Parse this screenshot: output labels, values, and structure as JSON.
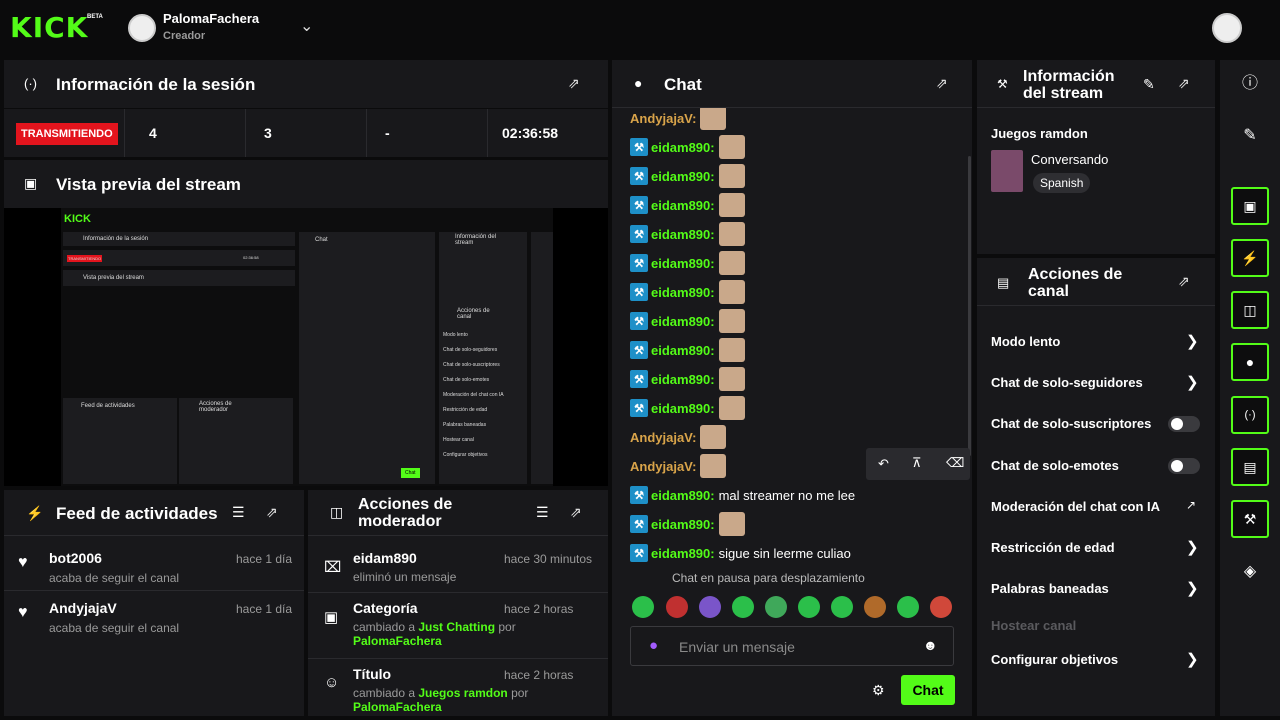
{
  "header": {
    "logo": "KICK",
    "beta": "BETA",
    "channel_name": "PalomaFachera",
    "channel_role": "Creador"
  },
  "session": {
    "title": "Información de la sesión",
    "status": "TRANSMITIENDO",
    "stat1": "4",
    "stat2": "3",
    "stat3": "-",
    "duration": "02:36:58"
  },
  "preview": {
    "title": "Vista previa del stream",
    "mini_logo": "KICK",
    "mini_session": "Información de la sesión",
    "mini_preview": "Vista previa del stream",
    "mini_chat": "Chat",
    "mini_info": "Información del stream",
    "mini_actions": "Acciones de canal",
    "mini_feed": "Feed de actividades",
    "mini_mod": "Acciones de moderador",
    "mini_status": "TRANSMITIENDO",
    "mini_time": "02:36:58",
    "mini_chat_btn": "Chat",
    "mini_rows": [
      "Modo lento",
      "Chat de solo-seguidores",
      "Chat de solo-suscriptores",
      "Chat de solo-emotes",
      "Moderación del chat con IA",
      "Restricción de edad",
      "Palabras baneadas",
      "Hostear canal",
      "Configurar objetivos"
    ]
  },
  "feed": {
    "title": "Feed de actividades",
    "items": [
      {
        "user": "bot2006",
        "action": "acaba de seguir el canal",
        "time": "hace 1 día"
      },
      {
        "user": "AndyjajaV",
        "action": "acaba de seguir el canal",
        "time": "hace 1 día"
      }
    ]
  },
  "modactions": {
    "title": "Acciones de moderador",
    "items": [
      {
        "title": "eidam890",
        "line1": "eliminó un mensaje",
        "time": "hace 30 minutos"
      },
      {
        "title": "Categoría",
        "pre": "cambiado a ",
        "value": "Just Chatting",
        "mid": " por",
        "by": "PalomaFachera",
        "time": "hace 2 horas"
      },
      {
        "title": "Título",
        "pre": "cambiado a ",
        "value": "Juegos ramdon",
        "mid": " por",
        "by": "PalomaFachera",
        "time": "hace 2 horas"
      }
    ]
  },
  "chat": {
    "title": "Chat",
    "messages": [
      {
        "user": "AndyjajaV:",
        "text": "",
        "color": "#d9a44a",
        "mod": false
      },
      {
        "user": "eidam890:",
        "text": "",
        "color": "#53fc18",
        "mod": true
      },
      {
        "user": "eidam890:",
        "text": "",
        "color": "#53fc18",
        "mod": true
      },
      {
        "user": "eidam890:",
        "text": "",
        "color": "#53fc18",
        "mod": true
      },
      {
        "user": "eidam890:",
        "text": "",
        "color": "#53fc18",
        "mod": true
      },
      {
        "user": "eidam890:",
        "text": "",
        "color": "#53fc18",
        "mod": true
      },
      {
        "user": "eidam890:",
        "text": "",
        "color": "#53fc18",
        "mod": true
      },
      {
        "user": "eidam890:",
        "text": "",
        "color": "#53fc18",
        "mod": true
      },
      {
        "user": "eidam890:",
        "text": "",
        "color": "#53fc18",
        "mod": true
      },
      {
        "user": "eidam890:",
        "text": "",
        "color": "#53fc18",
        "mod": true
      },
      {
        "user": "eidam890:",
        "text": "",
        "color": "#53fc18",
        "mod": true
      },
      {
        "user": "AndyjajaV:",
        "text": "",
        "color": "#d9a44a",
        "mod": false
      },
      {
        "user": "AndyjajaV:",
        "text": "",
        "color": "#d9a44a",
        "mod": false
      },
      {
        "user": "eidam890:",
        "text": "mal streamer no me lee",
        "color": "#53fc18",
        "mod": true
      },
      {
        "user": "eidam890:",
        "text": "",
        "color": "#53fc18",
        "mod": true
      },
      {
        "user": "eidam890:",
        "text": "sigue sin leerme culiao",
        "color": "#53fc18",
        "mod": true
      }
    ],
    "paused": "Chat en pausa para desplazamiento",
    "placeholder": "Enviar un mensaje",
    "send_label": "Chat"
  },
  "stream_info": {
    "title": "Información del stream",
    "stream_title": "Juegos ramdon",
    "category": "Conversando",
    "language": "Spanish"
  },
  "channel_actions": {
    "title": "Acciones de canal",
    "rows": [
      {
        "label": "Modo lento",
        "kind": "chevron"
      },
      {
        "label": "Chat de solo-seguidores",
        "kind": "chevron"
      },
      {
        "label": "Chat de solo-suscriptores",
        "kind": "toggle"
      },
      {
        "label": "Chat de solo-emotes",
        "kind": "toggle"
      },
      {
        "label": "Moderación del chat con IA",
        "kind": "external"
      },
      {
        "label": "Restricción de edad",
        "kind": "chevron"
      },
      {
        "label": "Palabras baneadas",
        "kind": "chevron"
      },
      {
        "label": "Hostear canal",
        "kind": "disabled"
      },
      {
        "label": "Configurar objetivos",
        "kind": "chevron"
      }
    ]
  },
  "colors": {
    "accent": "#53fc18",
    "live": "#e3141d",
    "panel": "#18181b"
  }
}
